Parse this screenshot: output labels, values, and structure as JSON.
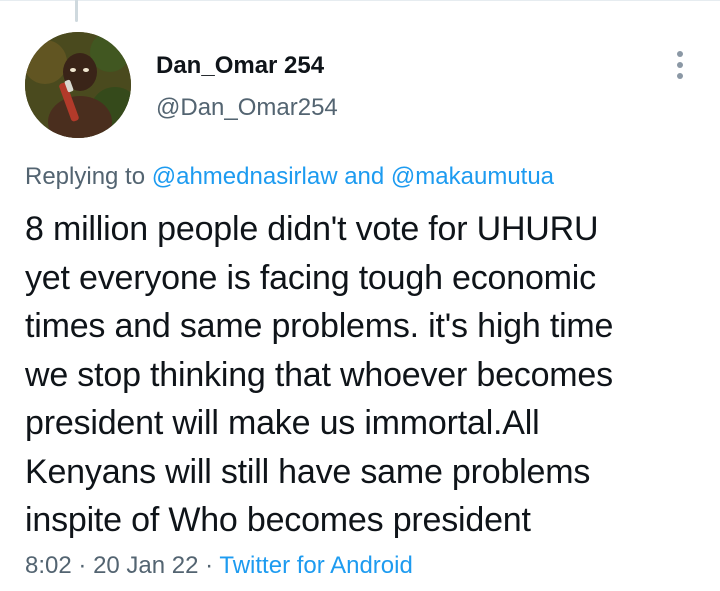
{
  "author": {
    "display_name": "Dan_Omar 254",
    "handle": "@Dan_Omar254"
  },
  "reply": {
    "prefix": "Replying to",
    "mention1": "@ahmednasirlaw",
    "conjunction": "and",
    "mention2": "@makaumutua"
  },
  "tweet": {
    "lines": [
      "8 million people didn't vote for UHURU",
      "yet everyone is facing tough economic",
      "times and same problems. it's high time",
      "we stop thinking that whoever becomes",
      "president will make us immortal.All",
      "Kenyans will still have same problems",
      "inspite of Who becomes president"
    ]
  },
  "meta": {
    "time": "8:02",
    "separator": "·",
    "date": "20 Jan 22",
    "source": "Twitter for Android"
  },
  "icons": {
    "more": "more-vertical-icon"
  },
  "colors": {
    "link": "#1d9bf0",
    "secondary": "#536471",
    "text": "#0f1419"
  }
}
